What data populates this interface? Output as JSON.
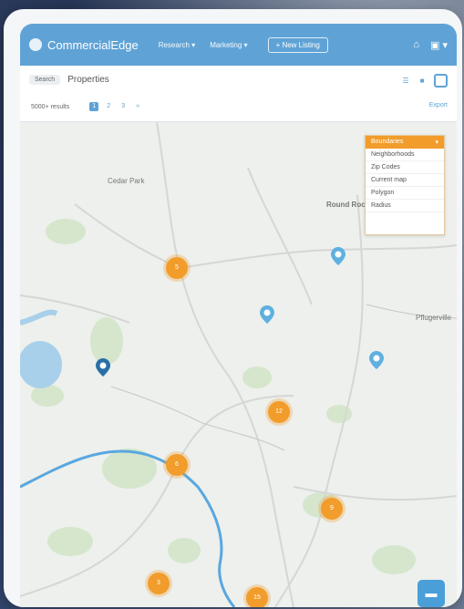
{
  "app": {
    "brand": "CommercialEdge",
    "nav": [
      "Research ▾",
      "Marketing ▾"
    ],
    "new_listing": "+ New Listing"
  },
  "panel": {
    "search_chip": "Search",
    "title": "Properties",
    "results": "5000+ results",
    "pages": [
      "1",
      "2",
      "3",
      "»"
    ],
    "export": "Export"
  },
  "map": {
    "labels": [
      "Cedar Park",
      "Round Rock",
      "Pflugerville"
    ],
    "clusters": [
      "5",
      "12",
      "6",
      "9",
      "3",
      "15"
    ]
  },
  "dropdown": {
    "header": "Boundaries",
    "items": [
      "Neighborhoods",
      "Zip Codes",
      "Current map",
      "Polygon",
      "Radius"
    ]
  },
  "colors": {
    "accent": "#5fa3d6",
    "cluster": "#f29c2b",
    "pin_light": "#5fb0e0",
    "pin_dark": "#2a6fa8",
    "river": "#59a7e0"
  }
}
